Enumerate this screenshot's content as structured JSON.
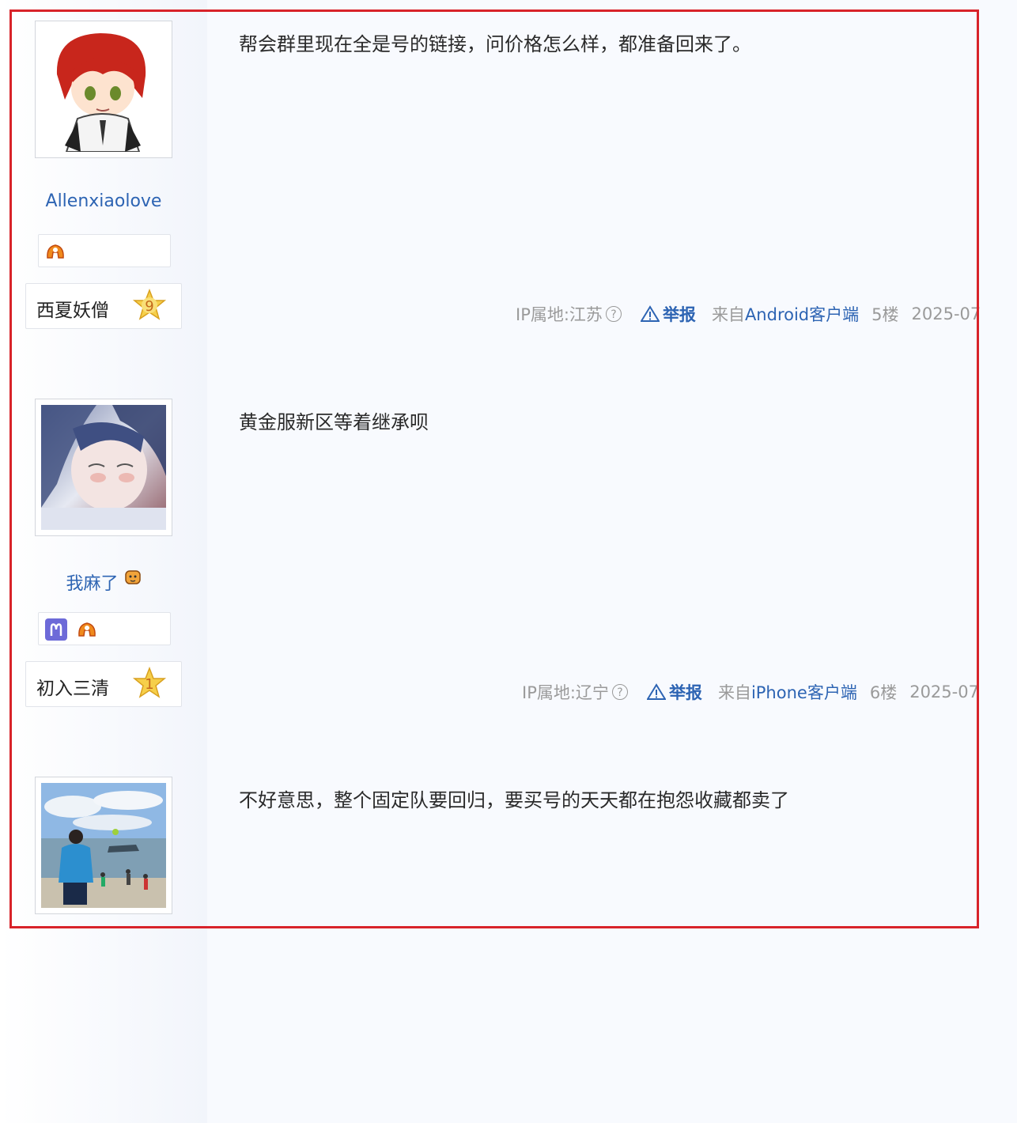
{
  "posts": [
    {
      "username": "Allenxiaolove",
      "title": "西夏妖僧",
      "level": "9",
      "content": "帮会群里现在全是号的链接，问价格怎么样，都准备回来了。",
      "ip": "IP属地:江苏",
      "report": "举报",
      "from_prefix": "来自",
      "client": "Android客户端",
      "floor": "5楼",
      "date": "2025-07"
    },
    {
      "username": "我麻了",
      "title": "初入三清",
      "level": "1",
      "content": "黄金服新区等着继承呗",
      "ip": "IP属地:辽宁",
      "report": "举报",
      "from_prefix": "来自",
      "client": "iPhone客户端",
      "floor": "6楼",
      "date": "2025-07"
    },
    {
      "content": "不好意思，整个固定队要回归，要买号的天天都在抱怨收藏都卖了"
    }
  ],
  "help_glyph": "?",
  "colors": {
    "link": "#2d64b3",
    "frame": "#d8232a",
    "meta": "#9a9a9a"
  },
  "icons": [
    "game-badge-icon",
    "aries-icon",
    "level-star-icon",
    "warning-icon",
    "help-icon"
  ]
}
